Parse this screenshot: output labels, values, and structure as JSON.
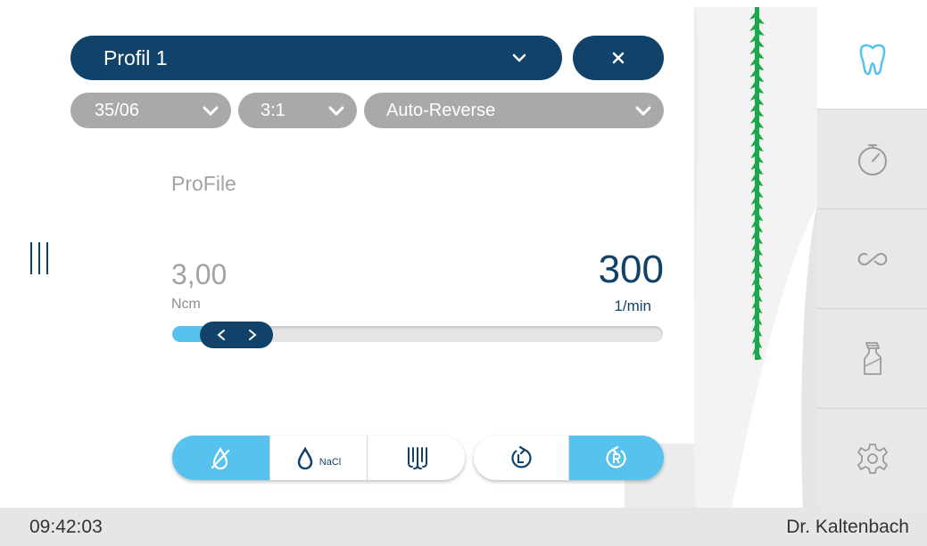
{
  "profile": {
    "selected": "Profil 1"
  },
  "settings": {
    "file_size": "35/06",
    "ratio": "3:1",
    "mode": "Auto-Reverse"
  },
  "file_system": {
    "name": "ProFile"
  },
  "torque": {
    "value": "3,00",
    "unit": "Ncm"
  },
  "speed": {
    "value": "300",
    "unit": "1/min",
    "slider_fraction": 0.12
  },
  "coolant": {
    "nacl_label": "NaCl",
    "active_option": "no-coolant"
  },
  "rotation": {
    "active": "right"
  },
  "sidebar": {
    "items": [
      "tooth-icon",
      "timer-icon",
      "infinity-icon",
      "spray-bottle-icon",
      "gear-icon"
    ],
    "active": "tooth-icon"
  },
  "status": {
    "time": "09:42:03",
    "user": "Dr. Kaltenbach"
  },
  "colors": {
    "primary": "#11426a",
    "accent": "#57c2ee",
    "grey_dropdown": "#a9a9a9",
    "file_green": "#1aa84a"
  }
}
